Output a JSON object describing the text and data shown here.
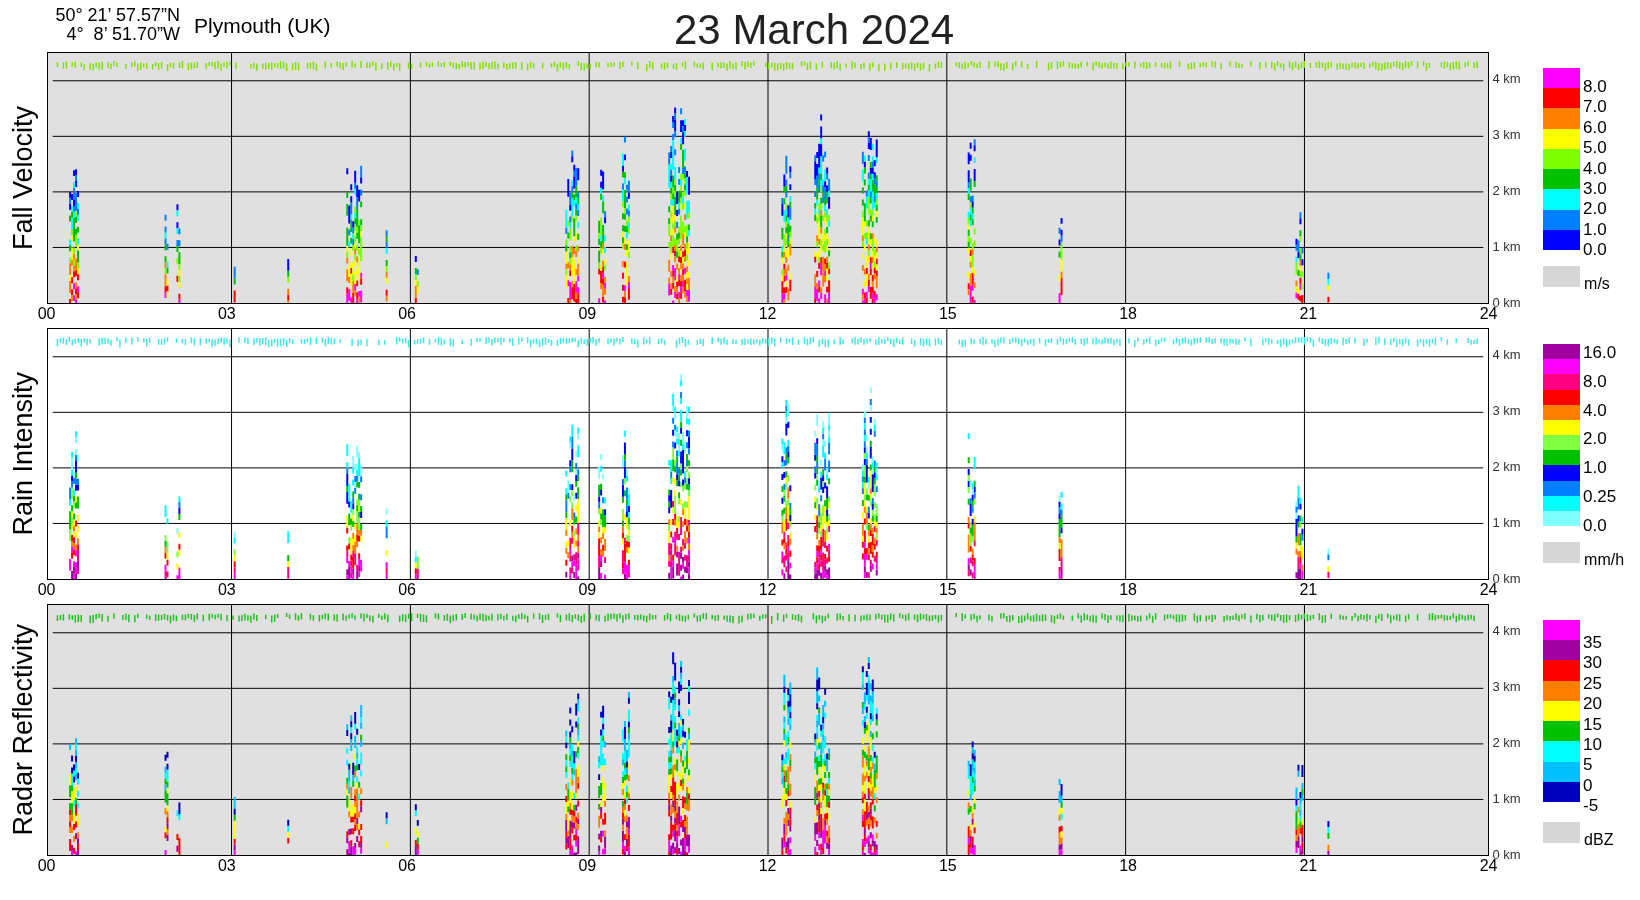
{
  "header": {
    "latitude": "50° 21’ 57.57”N",
    "longitude": "4°  8’ 51.70”W",
    "location": "Plymouth (UK)",
    "title": "23 March 2024"
  },
  "panels": [
    {
      "kind": "velocity",
      "title": "Fall Velocity",
      "height_labels": [
        "4 km",
        "3 km",
        "2 km",
        "1 km",
        "0 km"
      ],
      "time_labels": [
        "00",
        "03",
        "06",
        "09",
        "12",
        "15",
        "18",
        "21",
        "24"
      ],
      "legend": {
        "bands": [
          {
            "color": "#ff00ff"
          },
          {
            "color": "#ff0000"
          },
          {
            "color": "#ff8000"
          },
          {
            "color": "#ffff00"
          },
          {
            "color": "#80ff00"
          },
          {
            "color": "#00c000"
          },
          {
            "color": "#00ffff"
          },
          {
            "color": "#0080ff"
          },
          {
            "color": "#0000ff"
          }
        ],
        "labels": [
          "8.0",
          "7.0",
          "6.0",
          "5.0",
          "4.0",
          "3.0",
          "2.0",
          "1.0",
          "0.0"
        ],
        "unit": "m/s"
      }
    },
    {
      "kind": "rain",
      "title": "Rain Intensity",
      "height_labels": [
        "4 km",
        "3 km",
        "2 km",
        "1 km",
        "0 km"
      ],
      "time_labels": [
        "00",
        "03",
        "06",
        "09",
        "12",
        "15",
        "18",
        "21",
        "24"
      ],
      "legend": {
        "bands": [
          {
            "color": "#a000a0"
          },
          {
            "color": "#ff00ff"
          },
          {
            "color": "#ff0080"
          },
          {
            "color": "#ff0000"
          },
          {
            "color": "#ff8000"
          },
          {
            "color": "#ffff00"
          },
          {
            "color": "#80ff40"
          },
          {
            "color": "#00c000"
          },
          {
            "color": "#0000ff"
          },
          {
            "color": "#0080ff"
          },
          {
            "color": "#00ffff"
          },
          {
            "color": "#80ffff"
          }
        ],
        "labels": [
          "16.0",
          "8.0",
          "4.0",
          "2.0",
          "1.0",
          "0.25",
          "0.0"
        ],
        "unit": "mm/h"
      }
    },
    {
      "kind": "reflectivity",
      "title": "Radar Reflectivity",
      "height_labels": [
        "4 km",
        "3 km",
        "2 km",
        "1 km",
        "0 km"
      ],
      "time_labels": [
        "00",
        "03",
        "06",
        "09",
        "12",
        "15",
        "18",
        "21",
        "24"
      ],
      "legend": {
        "bands": [
          {
            "color": "#ff00ff"
          },
          {
            "color": "#a000a0"
          },
          {
            "color": "#ff0000"
          },
          {
            "color": "#ff8000"
          },
          {
            "color": "#ffff00"
          },
          {
            "color": "#00c000"
          },
          {
            "color": "#00ffff"
          },
          {
            "color": "#00c0ff"
          },
          {
            "color": "#0000c0"
          }
        ],
        "labels": [
          "35",
          "30",
          "25",
          "20",
          "15",
          "10",
          "5",
          "0",
          "-5"
        ],
        "unit": "dBZ"
      }
    }
  ]
}
